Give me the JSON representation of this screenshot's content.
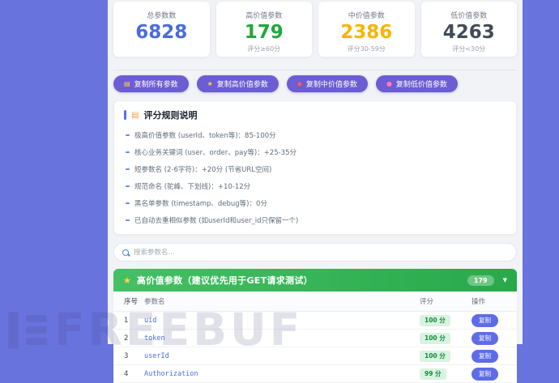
{
  "watermark": "FREEBUF",
  "colors": {
    "page_purple": "#6973de",
    "button_purple": "#6c5dd3",
    "header_green": "#2fb152",
    "stat_blue": "#4a6cdb",
    "stat_green": "#21a83c",
    "stat_orange": "#f7b500",
    "stat_dark": "#424b57",
    "score_green": "#178a3c",
    "param_blue": "#4a6ee0"
  },
  "stats": [
    {
      "label": "总参数数",
      "value": "6828",
      "note": ""
    },
    {
      "label": "高价值参数",
      "value": "179",
      "note": "评分≥60分"
    },
    {
      "label": "中价值参数",
      "value": "2386",
      "note": "评分30-59分"
    },
    {
      "label": "低价值参数",
      "value": "4263",
      "note": "评分<30分"
    }
  ],
  "actions": [
    {
      "label": "复制所有参数"
    },
    {
      "label": "复制高价值参数"
    },
    {
      "label": "复制中价值参数"
    },
    {
      "label": "复制低价值参数"
    }
  ],
  "rules": {
    "title": "评分规则说明",
    "items": [
      "极高价值参数 (userId、token等)：85-100分",
      "核心业务关键词 (user、order、pay等)：+25-35分",
      "短参数名 (2-6字符)：+20分 (节省URL空间)",
      "规范命名 (驼峰、下划线)：+10-12分",
      "黑名单参数 (timestamp、debug等)：0分",
      "已自动去重相似参数 (如userId和user_id只保留一个)"
    ]
  },
  "search": {
    "placeholder": "搜索参数名..."
  },
  "section": {
    "title": "高价值参数（建议优先用于GET请求测试）",
    "badge": "179"
  },
  "table": {
    "headers": [
      "序号",
      "参数名",
      "评分",
      "操作"
    ],
    "copy_label": "复制",
    "rows": [
      {
        "index": "1",
        "name": "uid",
        "score": "100 分"
      },
      {
        "index": "2",
        "name": "token",
        "score": "100 分"
      },
      {
        "index": "3",
        "name": "userId",
        "score": "100 分"
      },
      {
        "index": "4",
        "name": "Authorization",
        "score": "99 分"
      }
    ]
  }
}
